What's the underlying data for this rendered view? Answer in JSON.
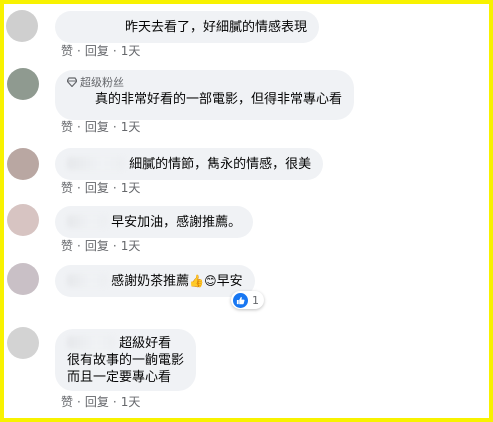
{
  "colors": {
    "frame_border": "#f8f200",
    "bubble_bg": "#f0f2f5",
    "text": "#050505",
    "meta_text": "#65676b",
    "like_blue": "#1877f2"
  },
  "actions": {
    "like": "赞",
    "reply": "回复",
    "separator": "·"
  },
  "comments": [
    {
      "text": "昨天去看了，好細膩的情感表現",
      "time": "1天"
    },
    {
      "badge": "超级粉丝",
      "badge_icon": "diamond-icon",
      "text": "真的非常好看的一部電影，但得非常專心看",
      "time": "1天"
    },
    {
      "text": "細膩的情節，雋永的情感，很美",
      "time": "1天"
    },
    {
      "text": "早安加油，感謝推薦。",
      "time": "1天"
    },
    {
      "text_before": "感謝奶茶推薦",
      "emoji_1": "👍",
      "emoji_2": "😊",
      "text_after": "早安",
      "reaction_icon": "like-icon",
      "reaction_count": "1"
    },
    {
      "lines": [
        "超級好看",
        "很有故事的一齣電影",
        "而且一定要專心看"
      ],
      "time": "1天"
    }
  ]
}
